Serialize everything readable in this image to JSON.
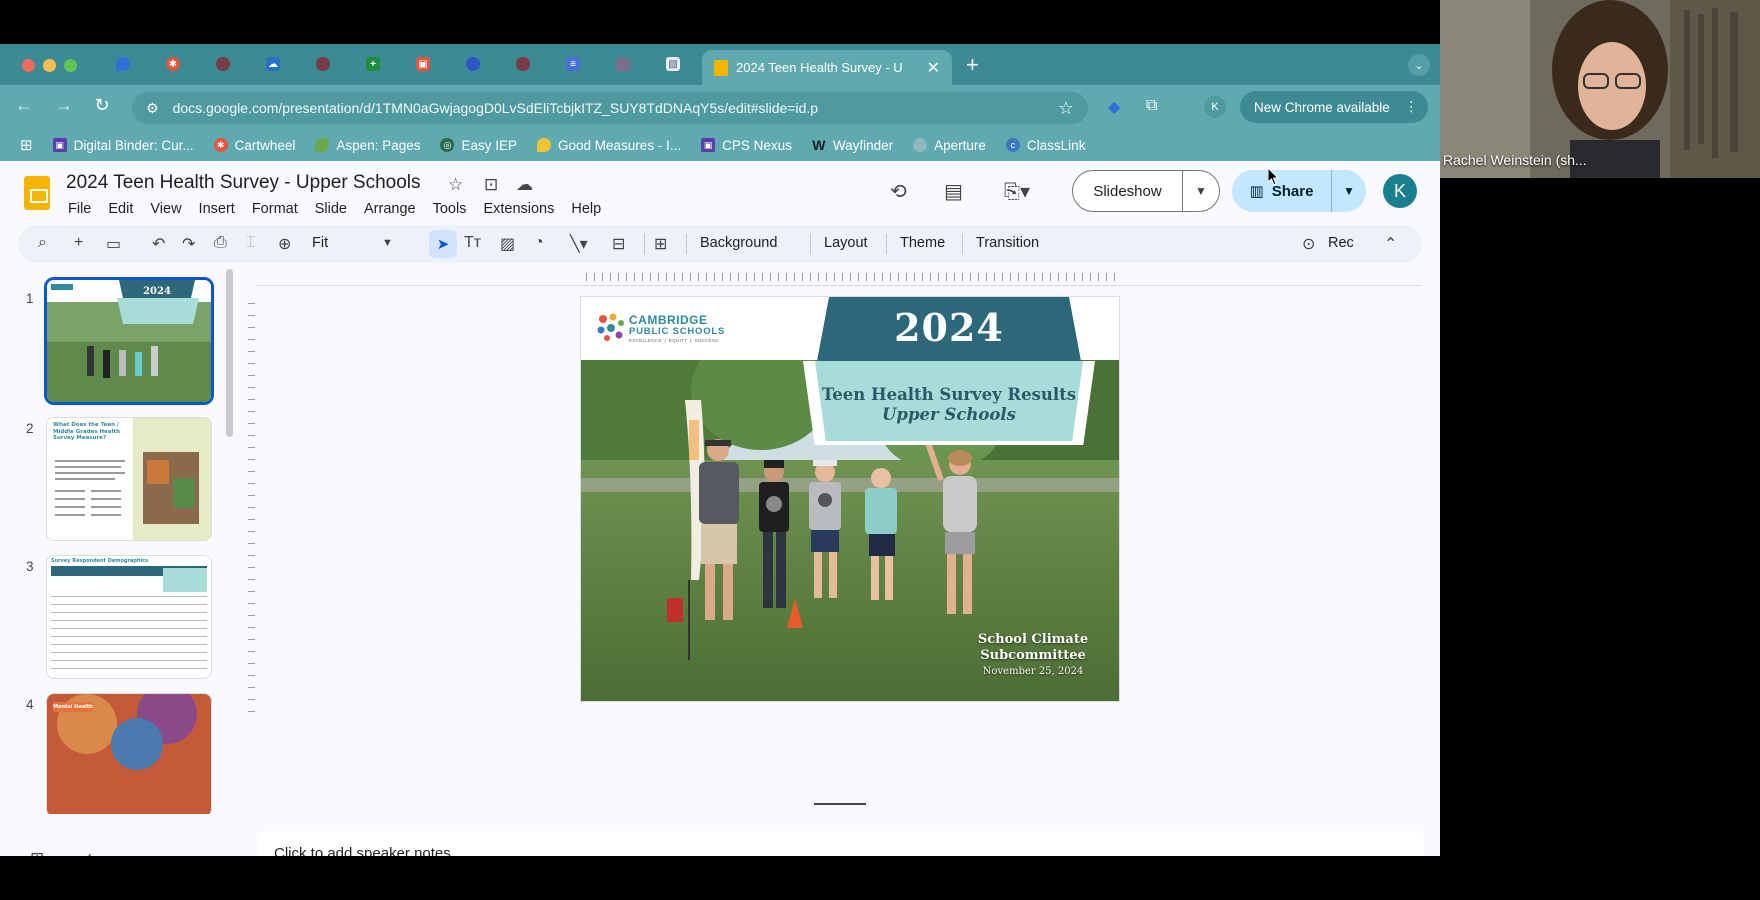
{
  "browser": {
    "active_tab_title": "2024 Teen Health Survey - U",
    "url": "docs.google.com/presentation/d/1TMN0aGwjagogD0LvSdEliTcbjkITZ_SUY8TdDNAqY5s/edit#slide=id.p",
    "new_chrome_label": "New Chrome available",
    "profile_letter": "K",
    "bookmarks": [
      {
        "label": "Digital Binder: Cur...",
        "color": "#5b3fa8"
      },
      {
        "label": "Cartwheel",
        "color": "#e8533e"
      },
      {
        "label": "Aspen: Pages",
        "color": "#6aa84f"
      },
      {
        "label": "Easy IEP",
        "color": "#2d6a4f"
      },
      {
        "label": "Good Measures - I...",
        "color": "#f1c232"
      },
      {
        "label": "CPS Nexus",
        "color": "#5b3fa8"
      },
      {
        "label": "Wayfinder",
        "color": "#1f1f1f"
      },
      {
        "label": "Aperture",
        "color": "#8fb8bd"
      },
      {
        "label": "ClassLink",
        "color": "#3b78c4"
      }
    ]
  },
  "app": {
    "doc_title": "2024 Teen Health Survey - Upper Schools",
    "menus": [
      "File",
      "Edit",
      "View",
      "Insert",
      "Format",
      "Slide",
      "Arrange",
      "Tools",
      "Extensions",
      "Help"
    ],
    "slideshow_label": "Slideshow",
    "share_label": "Share",
    "avatar_letter": "K",
    "toolbar": {
      "zoom": "Fit",
      "background": "Background",
      "layout": "Layout",
      "theme": "Theme",
      "transition": "Transition",
      "rec": "Rec"
    },
    "slide_numbers": [
      "1",
      "2",
      "3",
      "4"
    ],
    "speaker_notes_placeholder": "Click to add speaker notes"
  },
  "slide": {
    "year": "2024",
    "title_line1": "Teen Health Survey Results",
    "title_line2": "Upper Schools",
    "logo_line1": "CAMBRIDGE",
    "logo_line2": "PUBLIC SCHOOLS",
    "logo_line3": "EXCELLENCE ❘ EQUITY ❘ SUCCESS",
    "subtitle_line1": "School Climate",
    "subtitle_line2": "Subcommittee",
    "date": "November 25, 2024"
  },
  "thumbs": {
    "t2_heading": "What Does the Teen / Middle Grades Health Survey Measure?",
    "t3_heading": "Survey Respondent Demographics",
    "t4_badge": "Mental Health"
  },
  "call": {
    "participant_name": "Rachel Weinstein (sh..."
  },
  "colors": {
    "chrome_tab_strip": "#3d8a92",
    "chrome_toolbar": "#5fa9b0",
    "share_button": "#c2e7ff",
    "slide_banner": "#2c6879",
    "slide_banner_light": "#a8dcd8"
  }
}
